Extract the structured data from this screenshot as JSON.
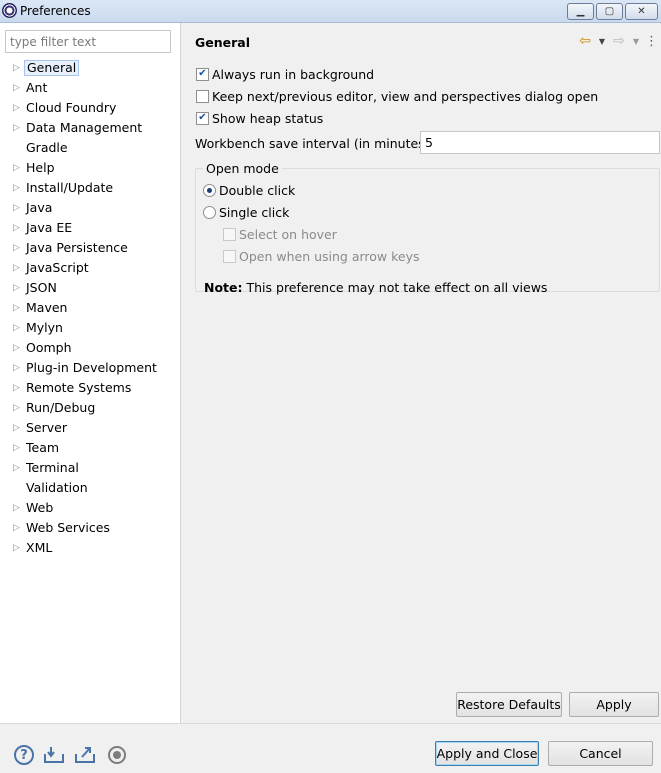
{
  "window": {
    "title": "Preferences",
    "controls": {
      "minimize": "▁",
      "maximize": "▢",
      "close": "✕"
    }
  },
  "filter": {
    "placeholder": "type filter text"
  },
  "tree": [
    {
      "label": "General",
      "expandable": true,
      "selected": true
    },
    {
      "label": "Ant",
      "expandable": true
    },
    {
      "label": "Cloud Foundry",
      "expandable": true
    },
    {
      "label": "Data Management",
      "expandable": true
    },
    {
      "label": "Gradle",
      "expandable": false
    },
    {
      "label": "Help",
      "expandable": true
    },
    {
      "label": "Install/Update",
      "expandable": true
    },
    {
      "label": "Java",
      "expandable": true
    },
    {
      "label": "Java EE",
      "expandable": true
    },
    {
      "label": "Java Persistence",
      "expandable": true
    },
    {
      "label": "JavaScript",
      "expandable": true
    },
    {
      "label": "JSON",
      "expandable": true
    },
    {
      "label": "Maven",
      "expandable": true
    },
    {
      "label": "Mylyn",
      "expandable": true
    },
    {
      "label": "Oomph",
      "expandable": true
    },
    {
      "label": "Plug-in Development",
      "expandable": true
    },
    {
      "label": "Remote Systems",
      "expandable": true
    },
    {
      "label": "Run/Debug",
      "expandable": true
    },
    {
      "label": "Server",
      "expandable": true
    },
    {
      "label": "Team",
      "expandable": true
    },
    {
      "label": "Terminal",
      "expandable": true
    },
    {
      "label": "Validation",
      "expandable": false
    },
    {
      "label": "Web",
      "expandable": true
    },
    {
      "label": "Web Services",
      "expandable": true
    },
    {
      "label": "XML",
      "expandable": true
    }
  ],
  "page": {
    "title": "General",
    "nav": {
      "back_icon": "⇦",
      "forward_icon": "⇨",
      "dropdown": "▼",
      "menu": "⋮"
    },
    "options": {
      "always_run_background": {
        "label": "Always run in background",
        "checked": true
      },
      "keep_next_prev": {
        "label": "Keep next/previous editor, view and perspectives dialog open",
        "checked": false
      },
      "show_heap": {
        "label": "Show heap status",
        "checked": true
      }
    },
    "save_interval": {
      "label": "Workbench save interval (in minutes):",
      "value": "5"
    },
    "open_mode": {
      "legend": "Open mode",
      "double_click": {
        "label": "Double click",
        "selected": true
      },
      "single_click": {
        "label": "Single click",
        "selected": false
      },
      "select_on_hover": {
        "label": "Select on hover",
        "checked": false,
        "enabled": false
      },
      "open_arrow_keys": {
        "label": "Open when using arrow keys",
        "checked": false,
        "enabled": false
      },
      "note_bold": "Note:",
      "note_text": " This preference may not take effect on all views"
    },
    "buttons": {
      "restore_defaults": "Restore Defaults",
      "apply": "Apply"
    }
  },
  "footer": {
    "buttons": {
      "apply_close": "Apply and Close",
      "cancel": "Cancel"
    },
    "icons": {
      "help": "?"
    }
  },
  "colors": {
    "selection_bg": "#e8f0fb",
    "selection_border": "#a7c4ea",
    "primary_border": "#3c7fb1"
  }
}
